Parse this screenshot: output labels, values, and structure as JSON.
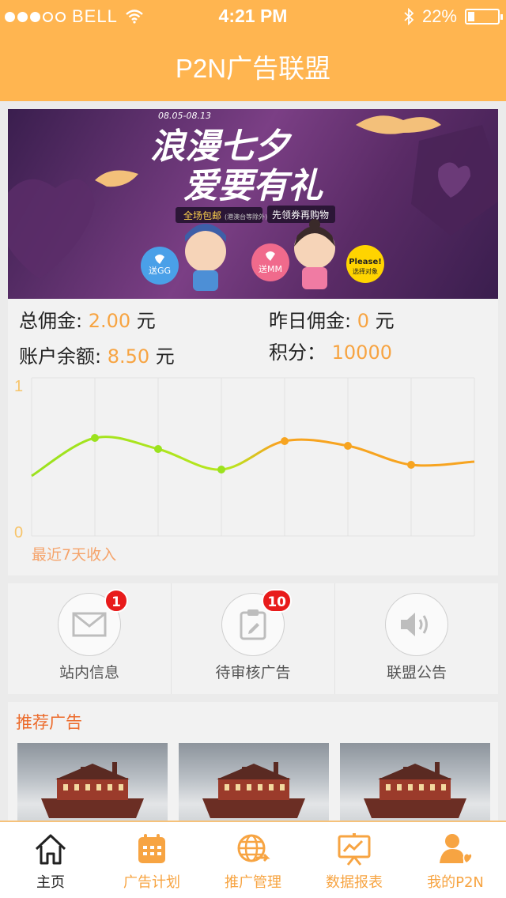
{
  "status_bar": {
    "carrier": "BELL",
    "time": "4:21 PM",
    "battery_percent": "22%",
    "battery_level": 0.22,
    "signal_bars_filled": 3,
    "signal_bars_total": 5
  },
  "header": {
    "title": "P2N广告联盟"
  },
  "banner": {
    "date_range": "08.05-08.13",
    "headline_line1": "浪漫七夕",
    "headline_line2": "爱要有礼",
    "promo_left": "全场包邮",
    "promo_note": "(港澳台等除外)",
    "promo_right": "先领券再购物",
    "bubble_gg": "送GG",
    "bubble_mm": "送MM",
    "bubble_please": "Please!",
    "bubble_please_sub": "选择对象"
  },
  "stats": {
    "total_commission_label": "总佣金: ",
    "total_commission_value": "2.00",
    "total_commission_unit": " 元",
    "yesterday_commission_label": "昨日佣金: ",
    "yesterday_commission_value": "0",
    "yesterday_commission_unit": " 元",
    "balance_label": "账户余额: ",
    "balance_value": "8.50",
    "balance_unit": " 元",
    "points_label": "积分：",
    "points_value": "10000"
  },
  "chart_data": {
    "type": "line",
    "caption": "最近7天收入",
    "ylim": [
      0,
      1
    ],
    "y_ticks": [
      "1",
      "0"
    ],
    "x": [
      0,
      1,
      2,
      3,
      4,
      5,
      6,
      7
    ],
    "values": [
      0.38,
      0.62,
      0.55,
      0.42,
      0.6,
      0.57,
      0.45,
      0.47
    ],
    "marked_points": [
      1,
      2,
      3,
      4,
      5,
      6
    ],
    "colors": {
      "start": "#9be21e",
      "end": "#f7a420",
      "grid": "#e2e2e2"
    }
  },
  "quick_actions": [
    {
      "label": "站内信息",
      "badge": "1",
      "icon": "envelope-icon"
    },
    {
      "label": "待审核广告",
      "badge": "10",
      "icon": "clipboard-icon"
    },
    {
      "label": "联盟公告",
      "badge": "",
      "icon": "speaker-icon"
    }
  ],
  "recommend": {
    "title": "推荐广告"
  },
  "tabbar": {
    "tabs": [
      {
        "label": "主页",
        "icon": "home-icon",
        "active": true
      },
      {
        "label": "广告计划",
        "icon": "calendar-icon",
        "active": false
      },
      {
        "label": "推广管理",
        "icon": "globe-icon",
        "active": false
      },
      {
        "label": "数据报表",
        "icon": "chart-board-icon",
        "active": false
      },
      {
        "label": "我的P2N",
        "icon": "user-heart-icon",
        "active": false
      }
    ]
  },
  "colors": {
    "accent": "#ffb550",
    "value": "#f7a442",
    "badge": "#e81b1b",
    "section_title": "#ec6a2a"
  }
}
